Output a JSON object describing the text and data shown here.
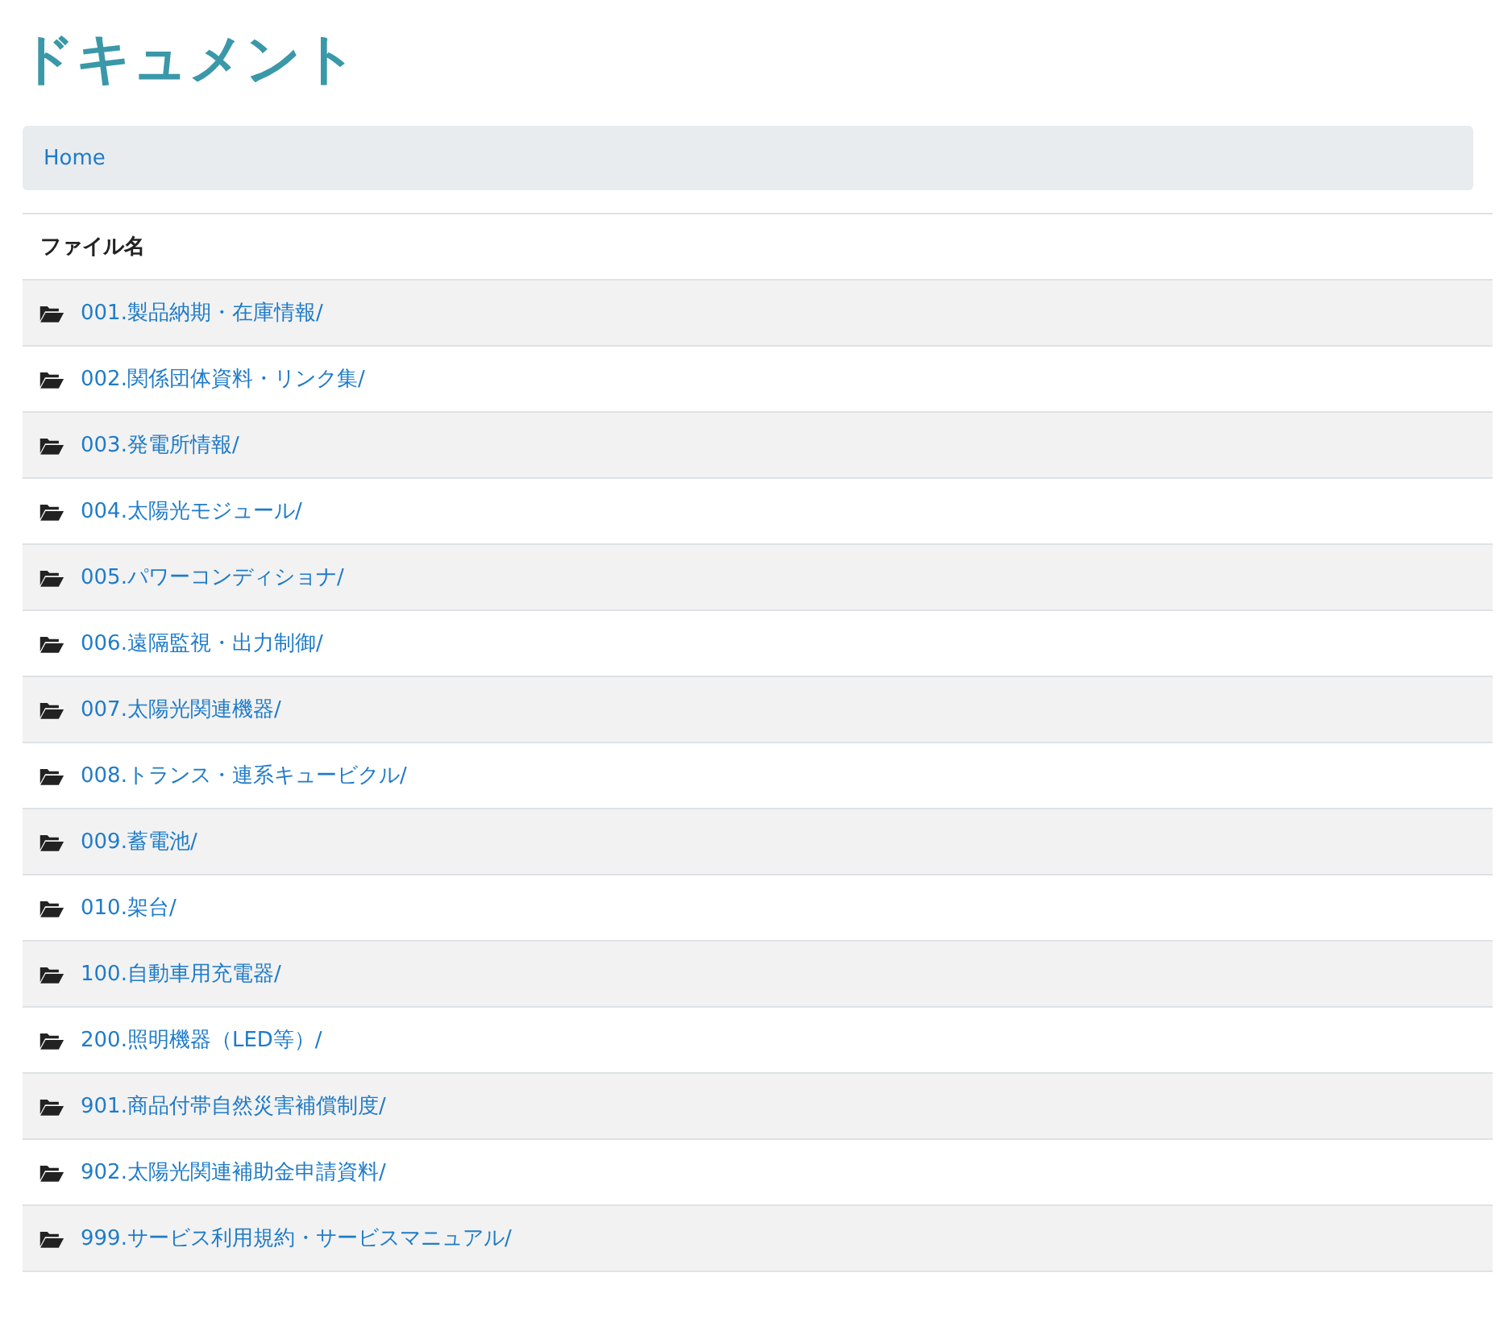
{
  "page_title": "ドキュメント",
  "breadcrumb": [
    {
      "label": "Home"
    }
  ],
  "table": {
    "columns": [
      "ファイル名"
    ],
    "rows": [
      {
        "name": "001.製品納期・在庫情報/"
      },
      {
        "name": "002.関係団体資料・リンク集/"
      },
      {
        "name": "003.発電所情報/"
      },
      {
        "name": "004.太陽光モジュール/"
      },
      {
        "name": "005.パワーコンディショナ/"
      },
      {
        "name": "006.遠隔監視・出力制御/"
      },
      {
        "name": "007.太陽光関連機器/"
      },
      {
        "name": "008.トランス・連系キュービクル/"
      },
      {
        "name": "009.蓄電池/"
      },
      {
        "name": "010.架台/"
      },
      {
        "name": "100.自動車用充電器/"
      },
      {
        "name": "200.照明機器（LED等）/"
      },
      {
        "name": "901.商品付帯自然災害補償制度/"
      },
      {
        "name": "902.太陽光関連補助金申請資料/"
      },
      {
        "name": "999.サービス利用規約・サービスマニュアル/"
      }
    ]
  }
}
